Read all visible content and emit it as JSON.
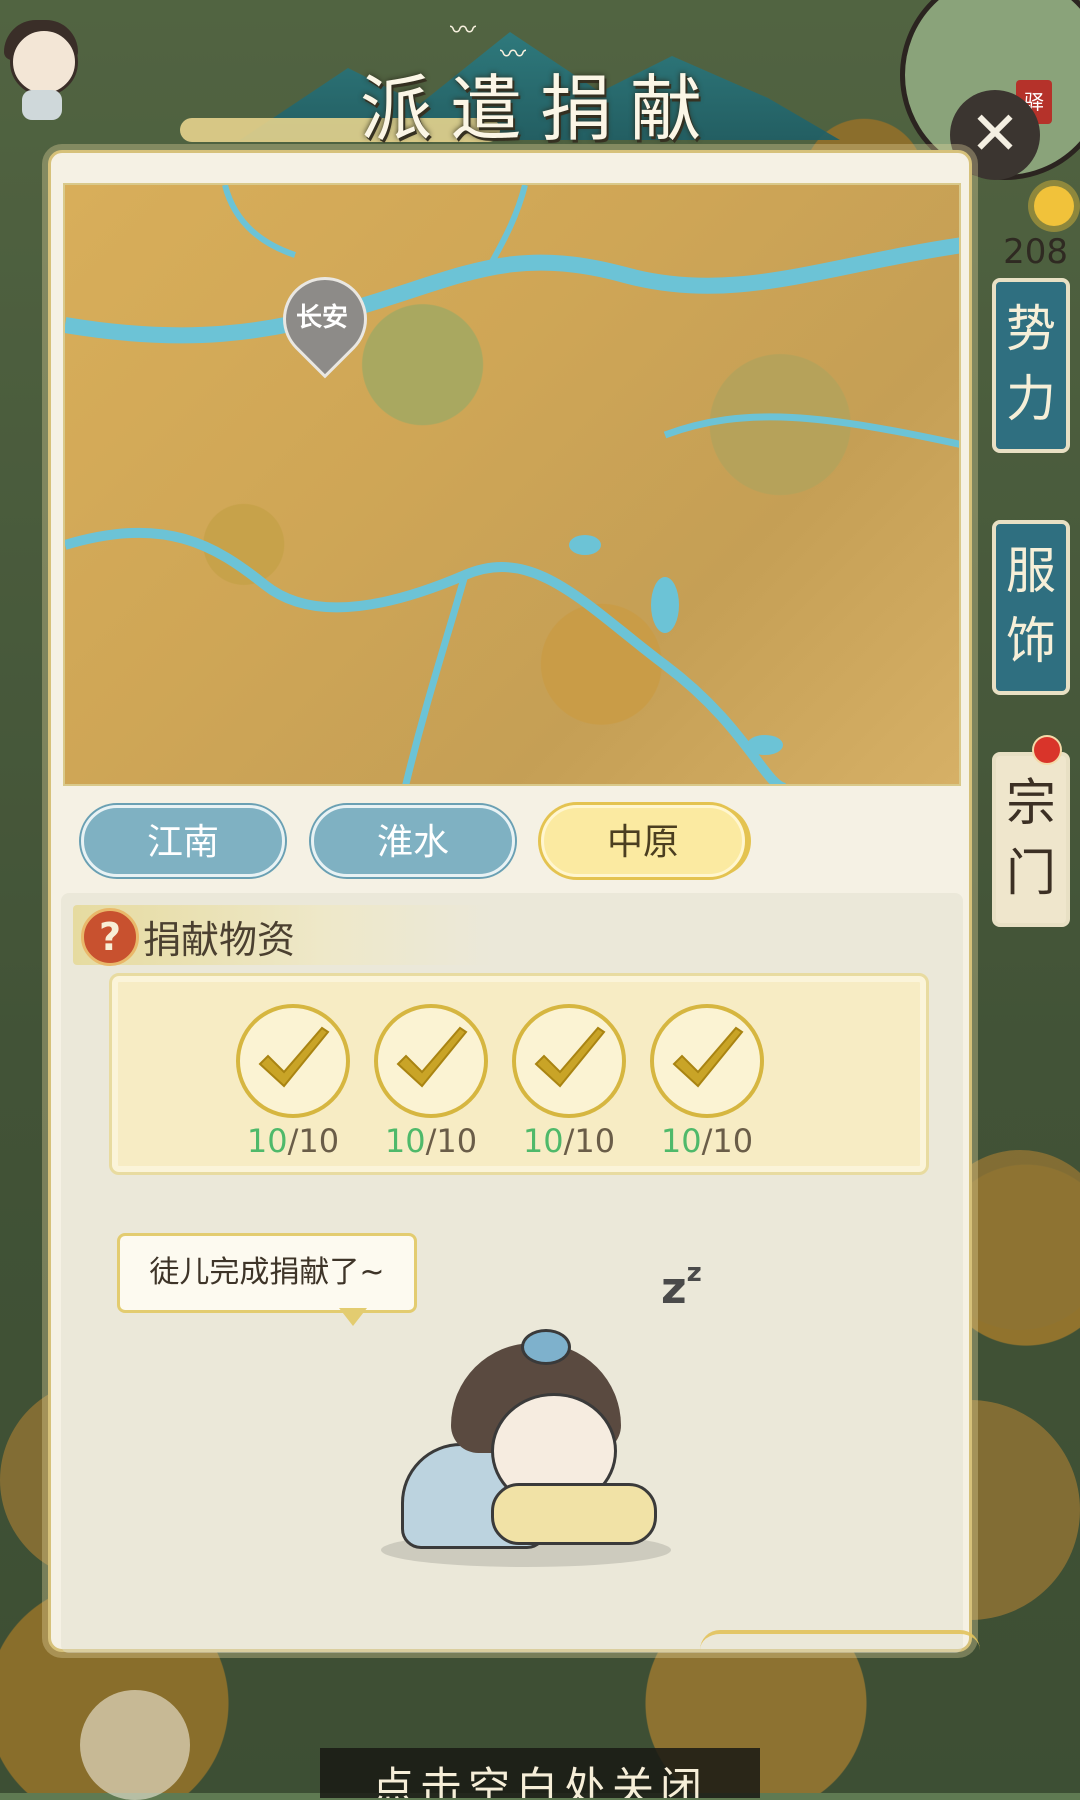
{
  "title": "派遣捐献",
  "map": {
    "pin_label": "长安"
  },
  "tabs": [
    {
      "label": "江南",
      "active": false
    },
    {
      "label": "淮水",
      "active": false
    },
    {
      "label": "中原",
      "active": true
    }
  ],
  "section": {
    "title": "捐献物资",
    "help_icon": "question-icon"
  },
  "items": [
    {
      "got": "10",
      "total": "/10",
      "status": "check-icon"
    },
    {
      "got": "10",
      "total": "/10",
      "status": "check-icon"
    },
    {
      "got": "10",
      "total": "/10",
      "status": "check-icon"
    },
    {
      "got": "10",
      "total": "/10",
      "status": "check-icon"
    }
  ],
  "speech_bubble": "徒儿完成捐献了~",
  "sleep_text": "z",
  "sleep_text_small": "z",
  "hud": {
    "count": "208",
    "side_buttons": [
      "势力",
      "服饰",
      "宗门"
    ],
    "badge": "驿",
    "close_hint": "点击空白处关闭"
  },
  "colors": {
    "tab_inactive": "#7fb1c2",
    "tab_active": "#fbeaa1",
    "check_gold": "#d6b640",
    "count_green": "#4fb96a"
  }
}
